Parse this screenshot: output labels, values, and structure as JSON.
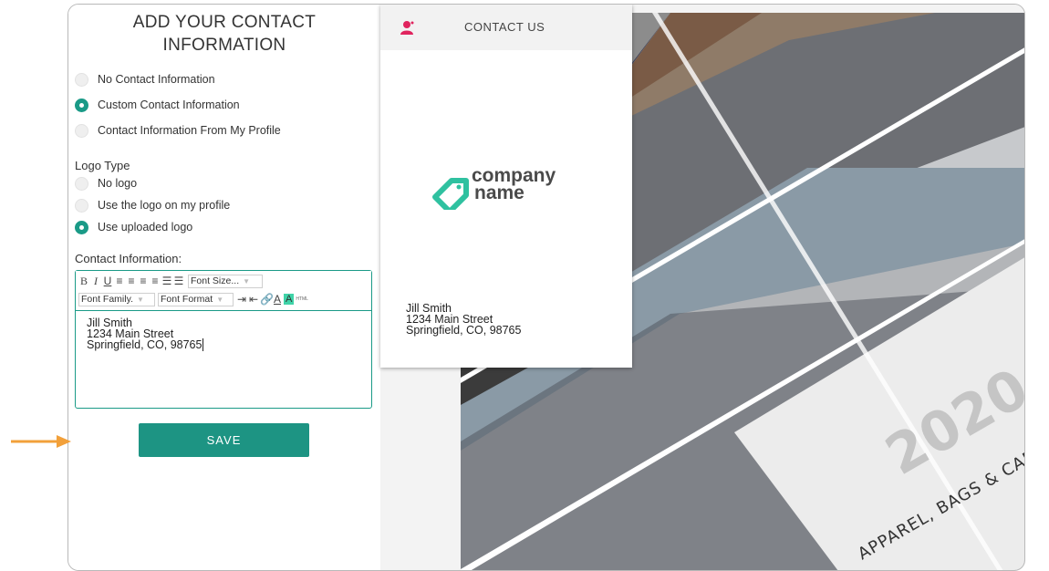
{
  "form": {
    "title_line1": "ADD YOUR CONTACT",
    "title_line2": "INFORMATION",
    "contact_options": [
      {
        "label": "No Contact Information",
        "selected": false
      },
      {
        "label": "Custom Contact Information",
        "selected": true
      },
      {
        "label": "Contact Information From My Profile",
        "selected": false
      }
    ],
    "logo_type_label": "Logo Type",
    "logo_options": [
      {
        "label": "No logo",
        "selected": false
      },
      {
        "label": "Use the logo on my profile",
        "selected": false
      },
      {
        "label": "Use uploaded logo",
        "selected": true
      }
    ],
    "contact_info_label": "Contact Information:",
    "save_label": "SAVE"
  },
  "editor": {
    "toolbar": {
      "font_size": "Font Size...",
      "font_family": "Font Family.",
      "font_format": "Font Format",
      "html_label": "HTML"
    },
    "content": {
      "line1": "Jill Smith",
      "line2": "1234 Main Street",
      "line3": "Springfield, CO, 98765"
    }
  },
  "preview": {
    "contact_title": "CONTACT US",
    "logo_line1": "company",
    "logo_line2": "name",
    "address": {
      "line1": "Jill Smith",
      "line2": "1234 Main Street",
      "line3": "Springfield, CO, 98765"
    },
    "catalog_text": "APPAREL, BAGS & CAPS",
    "catalog_year": "2020"
  },
  "colors": {
    "accent": "#1a9a87",
    "save_bg": "#1d9483",
    "arrow": "#f2a03a",
    "contact_icon": "#e0245e"
  }
}
